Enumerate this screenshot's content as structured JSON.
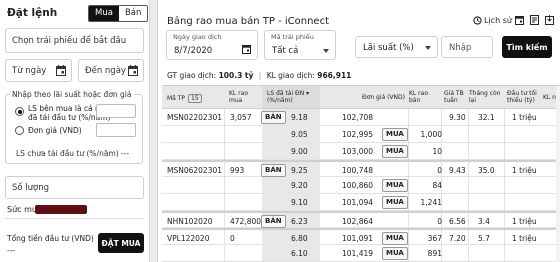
{
  "order_panel": {
    "title": "Đặt lệnh",
    "toggle": {
      "buy": "Mua",
      "sell": "Bán"
    },
    "bond_select": {
      "placeholder": "Chọn trái phiếu để bắt đầu"
    },
    "from_date": {
      "label": "Từ ngày"
    },
    "to_date": {
      "label": "Đến ngày"
    },
    "group_label": "Nhập theo lãi suất hoặc đơn giá",
    "option_rate": {
      "line1": "LS bên mua là cá nhân",
      "line2": "đã tái đầu tư (%/năm)"
    },
    "option_price": {
      "label": "Đơn giá (VND)"
    },
    "unreinvested_rate": "LS chưa tái đầu tư (%/năm)  ---",
    "quantity": {
      "placeholder": "Số lượng"
    },
    "buying_power_label": "Sức mua",
    "total_label": "Tổng tiền đầu tư (VND)",
    "total_value": "---",
    "submit_label": "ĐẶT MUA"
  },
  "board": {
    "title": "Bảng rao mua bán TP - iConnect",
    "history_label": "Lịch sử",
    "trade_date": {
      "label": "Ngày giao dịch",
      "value": "8/7/2020"
    },
    "bond_code": {
      "label": "Mã trái phiếu",
      "value": "Tất cả"
    },
    "rate_select": {
      "value": "Lãi suất (%)"
    },
    "input": {
      "placeholder": "Nhập"
    },
    "search_label": "Tìm kiếm",
    "gt_label": "GT giao dịch:",
    "gt_value": "100.3 tỷ",
    "kl_label": "KL giao dịch:",
    "kl_value": "966,911",
    "columns": {
      "code": "Mã TP",
      "code_badge": "15",
      "kl_buy": [
        "KL rao",
        "mua"
      ],
      "rate": [
        "LS đã tái ĐN",
        "(%/năm)"
      ],
      "price": "Đơn giá (VND)",
      "kl_sell": [
        "KL rao",
        "bán"
      ],
      "avg_price": [
        "Giá TB",
        "tuần"
      ],
      "remaining_months": [
        "Tháng còn",
        "lại"
      ],
      "min_invest": [
        "Đầu tư tối",
        "thiểu (tỷ)"
      ],
      "more": "KL n"
    },
    "rows": [
      {
        "code": "MSN02202301",
        "kl_buy": "3,057",
        "buy_btn": "BÁN",
        "rate": "9.18",
        "price": "102,708",
        "sell_btn": "",
        "kl_sell": "",
        "avg": "9.30",
        "months": "32.1",
        "min": "1 triệu"
      },
      {
        "code": "",
        "kl_buy": "",
        "buy_btn": "",
        "rate": "9.05",
        "price": "102,995",
        "sell_btn": "MUA",
        "kl_sell": "1,000",
        "avg": "",
        "months": "",
        "min": ""
      },
      {
        "code": "",
        "kl_buy": "",
        "buy_btn": "",
        "rate": "9.00",
        "price": "103,000",
        "sell_btn": "MUA",
        "kl_sell": "10",
        "avg": "",
        "months": "",
        "min": ""
      },
      {
        "code": "MSN06202301",
        "kl_buy": "993",
        "buy_btn": "BÁN",
        "rate": "9.25",
        "price": "100,748",
        "sell_btn": "",
        "kl_sell": "0",
        "avg": "9.43",
        "months": "35.0",
        "min": "1 triệu"
      },
      {
        "code": "",
        "kl_buy": "",
        "buy_btn": "",
        "rate": "9.20",
        "price": "100,860",
        "sell_btn": "MUA",
        "kl_sell": "84",
        "avg": "",
        "months": "",
        "min": ""
      },
      {
        "code": "",
        "kl_buy": "",
        "buy_btn": "",
        "rate": "9.10",
        "price": "101,094",
        "sell_btn": "MUA",
        "kl_sell": "1,241",
        "avg": "",
        "months": "",
        "min": ""
      },
      {
        "code": "NHN102020",
        "kl_buy": "472,800",
        "buy_btn": "BÁN",
        "rate": "6.23",
        "price": "102,864",
        "sell_btn": "",
        "kl_sell": "0",
        "avg": "6.56",
        "months": "3.4",
        "min": "1 triệu"
      },
      {
        "code": "VPL122020",
        "kl_buy": "0",
        "buy_btn": "",
        "rate": "6.80",
        "price": "101,091",
        "sell_btn": "MUA",
        "kl_sell": "367",
        "avg": "7.20",
        "months": "5.7",
        "min": "1 triệu"
      },
      {
        "code": "",
        "kl_buy": "",
        "buy_btn": "",
        "rate": "6.10",
        "price": "101,419",
        "sell_btn": "MUA",
        "kl_sell": "891",
        "avg": "",
        "months": "",
        "min": ""
      }
    ]
  }
}
